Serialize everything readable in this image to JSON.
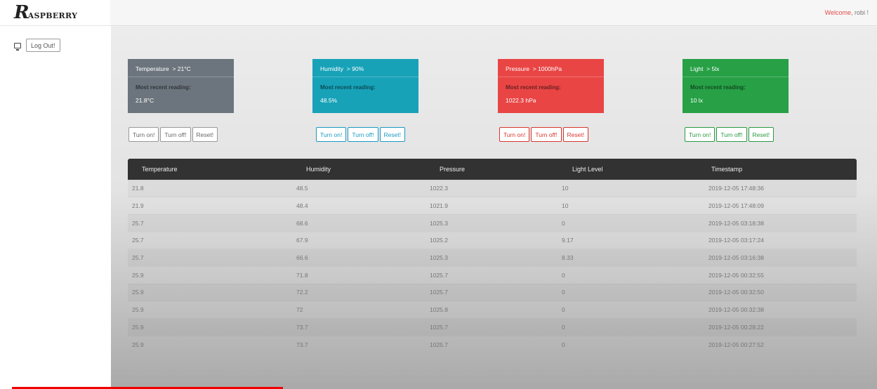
{
  "app": {
    "logo_mark": "R",
    "logo_text": "ASPBERRY",
    "welcome_prefix": "Welcome,",
    "welcome_user": "robi !",
    "logout_label": "Log Out!"
  },
  "cards": [
    {
      "title": "Temperature",
      "threshold": "> 21°C",
      "recent_label": "Most recent reading:",
      "value": "21.8°C",
      "color": "#6c757d"
    },
    {
      "title": "Humidity",
      "threshold": "> 90%",
      "recent_label": "Most recent reading:",
      "value": "48.5%",
      "color": "#17a2b8"
    },
    {
      "title": "Pressure",
      "threshold": "> 1000hPa",
      "recent_label": "Most recent reading:",
      "value": "1022.3  hPa",
      "color": "#e94545"
    },
    {
      "title": "Light",
      "threshold": "> 5lx",
      "recent_label": "Most recent reading:",
      "value": "10  lx",
      "color": "#27a046"
    }
  ],
  "buttons": {
    "on": "Turn on!",
    "off": "Turn off!",
    "reset": "Reset!"
  },
  "table": {
    "headers": [
      "Temperature",
      "Humidity",
      "Pressure",
      "Light Level",
      "Timestamp"
    ],
    "rows": [
      [
        "21.8",
        "48.5",
        "1022.3",
        "10",
        "2019-12-05 17:48:36"
      ],
      [
        "21.9",
        "48.4",
        "1021.9",
        "10",
        "2019-12-05 17:48:09"
      ],
      [
        "25.7",
        "68.6",
        "1025.3",
        "0",
        "2019-12-05 03:18:38"
      ],
      [
        "25.7",
        "67.9",
        "1025.2",
        "9.17",
        "2019-12-05 03:17:24"
      ],
      [
        "25.7",
        "66.6",
        "1025.3",
        "8.33",
        "2019-12-05 03:16:38"
      ],
      [
        "25.9",
        "71.8",
        "1025.7",
        "0",
        "2019-12-05 00:32:55"
      ],
      [
        "25.9",
        "72.2",
        "1025.7",
        "0",
        "2019-12-05 00:32:50"
      ],
      [
        "25.9",
        "72",
        "1025.8",
        "0",
        "2019-12-05 00:32:38"
      ],
      [
        "25.9",
        "73.7",
        "1025.7",
        "0",
        "2019-12-05 00:28:22"
      ],
      [
        "25.9",
        "73.7",
        "1025.7",
        "0",
        "2019-12-05 00:27:52"
      ]
    ]
  }
}
